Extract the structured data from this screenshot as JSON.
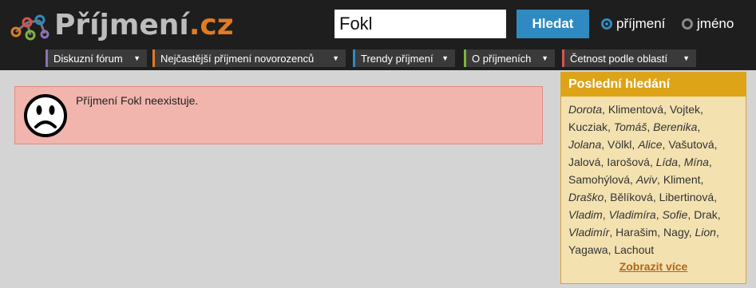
{
  "logo": {
    "name": "Příjmení",
    "tld": ".cz"
  },
  "search": {
    "value": "Fokl",
    "button_label": "Hledat"
  },
  "radios": {
    "surname_label": "příjmení",
    "name_label": "jméno",
    "selected": "příjmení"
  },
  "nav": [
    {
      "label": "Diskuzní fórum",
      "color": "#8e6fb5"
    },
    {
      "label": "Nejčastější příjmení novorozenců",
      "color": "#e07b23"
    },
    {
      "label": "Trendy příjmení",
      "color": "#2f8ac2"
    },
    {
      "label": "O příjmeních",
      "color": "#7fb43a"
    },
    {
      "label": "Četnost podle oblastí",
      "color": "#d9534f"
    }
  ],
  "alert": {
    "message": "Příjmení Fokl neexistuje."
  },
  "sidebar": {
    "title": "Poslední hledání",
    "items": [
      {
        "text": "Dorota",
        "italic": true
      },
      {
        "text": "Klimentová",
        "italic": false
      },
      {
        "text": "Vojtek",
        "italic": false
      },
      {
        "text": "Kucziak",
        "italic": false
      },
      {
        "text": "Tomáš",
        "italic": true
      },
      {
        "text": "Berenika",
        "italic": true
      },
      {
        "text": "Jolana",
        "italic": true
      },
      {
        "text": "Völkl",
        "italic": false
      },
      {
        "text": "Alice",
        "italic": true
      },
      {
        "text": "Vašutová",
        "italic": false
      },
      {
        "text": "Jalová",
        "italic": false
      },
      {
        "text": "Iarošová",
        "italic": false
      },
      {
        "text": "Lída",
        "italic": true
      },
      {
        "text": "Mína",
        "italic": true
      },
      {
        "text": "Samohýlová",
        "italic": false
      },
      {
        "text": "Aviv",
        "italic": true
      },
      {
        "text": "Kliment",
        "italic": false
      },
      {
        "text": "Draško",
        "italic": true
      },
      {
        "text": "Bělíková",
        "italic": false
      },
      {
        "text": "Libertinová",
        "italic": false
      },
      {
        "text": "Vladim",
        "italic": true
      },
      {
        "text": "Vladimíra",
        "italic": true
      },
      {
        "text": "Sofie",
        "italic": true
      },
      {
        "text": "Drak",
        "italic": false
      },
      {
        "text": "Vladimír",
        "italic": true
      },
      {
        "text": "Harašim",
        "italic": false
      },
      {
        "text": "Nagy",
        "italic": false
      },
      {
        "text": "Lion",
        "italic": true
      },
      {
        "text": "Yagawa",
        "italic": false
      },
      {
        "text": "Lachout",
        "italic": false
      }
    ],
    "more_label": "Zobrazit více"
  }
}
